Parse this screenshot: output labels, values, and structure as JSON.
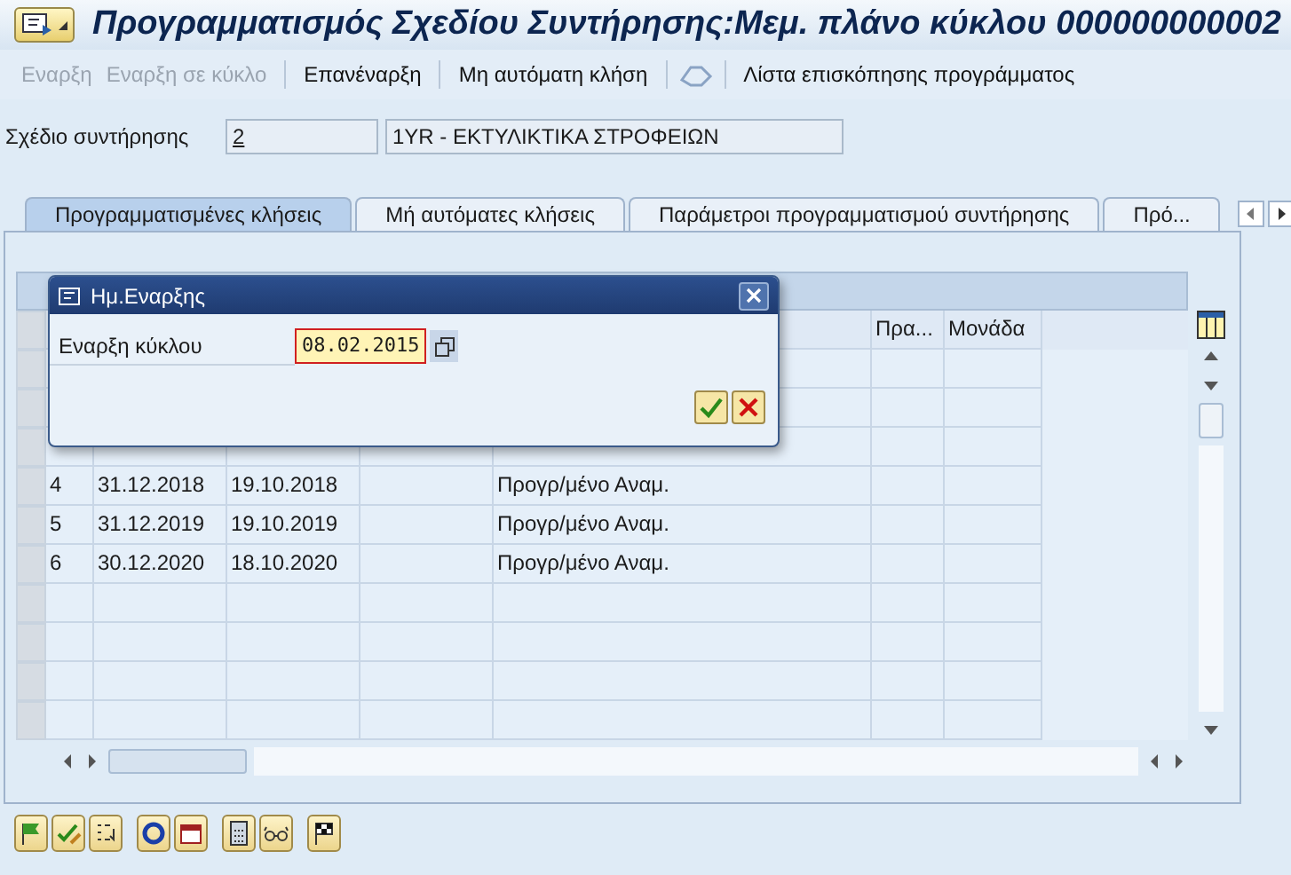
{
  "window": {
    "title": "Προγραμματισμός Σχεδίου Συντήρησης:Μεμ. πλάνο κύκλου 000000000002"
  },
  "toolbar": [
    {
      "label": "Εναρξη",
      "disabled": true
    },
    {
      "label": "Εναρξη σε κύκλο",
      "disabled": true
    },
    {
      "label": "Επανέναρξη",
      "disabled": false
    },
    {
      "label": "Μη αυτόματη κλήση",
      "disabled": false
    },
    {
      "label": "Λίστα επισκόπησης προγράμματος",
      "disabled": false
    }
  ],
  "plan": {
    "label": "Σχέδιο συντήρησης",
    "number": "2",
    "description": "1YR - ΕΚΤΥΛΙΚΤΙΚΑ ΣΤΡΟΦΕΙΩΝ"
  },
  "tabs": [
    {
      "label": "Προγραμματισμένες κλήσεις",
      "selected": true
    },
    {
      "label": "Μή αυτόματες κλήσεις",
      "selected": false
    },
    {
      "label": "Παράμετροι προγραμματισμού συντήρησης",
      "selected": false
    },
    {
      "label": "Πρό...",
      "selected": false
    }
  ],
  "table": {
    "columns": [
      "Πρα...",
      "Μονάδα"
    ],
    "rows": [
      {
        "number": "4",
        "date_1": "31.12.2018",
        "date_2": "19.10.2018",
        "status": "Προγρ/μένο Αναμ."
      },
      {
        "number": "5",
        "date_1": "31.12.2019",
        "date_2": "19.10.2019",
        "status": "Προγρ/μένο Αναμ."
      },
      {
        "number": "6",
        "date_1": "30.12.2020",
        "date_2": "18.10.2020",
        "status": "Προγρ/μένο Αναμ."
      }
    ]
  },
  "dialog": {
    "title": "Ημ.Εναρξης",
    "field_label": "Εναρξη κύκλου",
    "field_value": "08.02.2015"
  }
}
